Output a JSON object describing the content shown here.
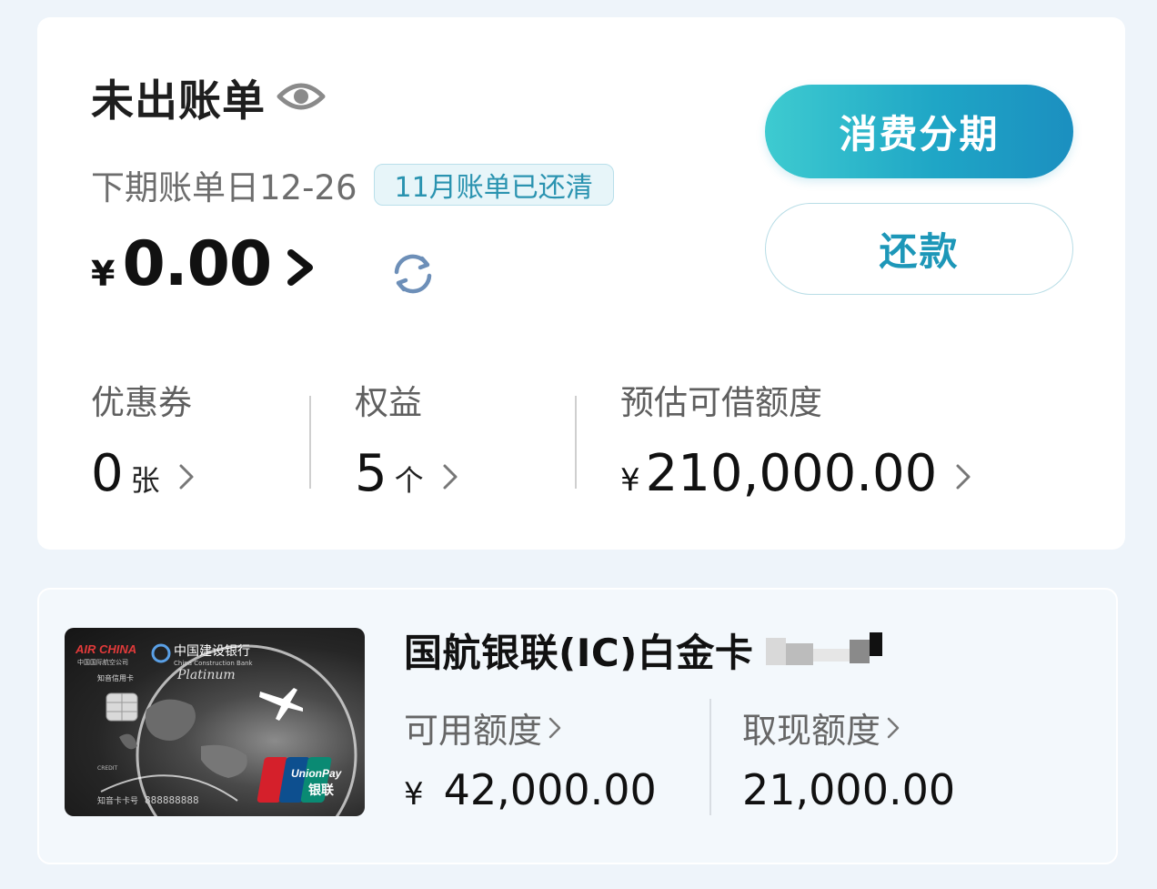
{
  "bill": {
    "title": "未出账单",
    "next_bill_date": "下期账单日12-26",
    "paid_badge": "11月账单已还清",
    "currency": "¥",
    "amount": "0.00",
    "actions": {
      "installment": "消费分期",
      "repay": "还款"
    }
  },
  "stats": [
    {
      "label": "优惠券",
      "value": "0",
      "unit": "张"
    },
    {
      "label": "权益",
      "value": "5",
      "unit": "个"
    },
    {
      "label": "预估可借额度",
      "currency": "¥",
      "value": "210,000.00"
    }
  ],
  "card": {
    "name": "国航银联(IC)白金卡",
    "image_text": {
      "airline": "AIR CHINA",
      "airline_cn": "中国国际航空公司",
      "bank": "中国建设银行",
      "bank_en": "China Construction Bank",
      "card_type": "知音信用卡",
      "tier": "Platinum",
      "network": "UnionPay",
      "network_cn": "银联",
      "card_no_label": "知音卡卡号",
      "card_no": "888888888",
      "credit": "CREDIT"
    },
    "available_limit": {
      "label": "可用额度",
      "currency": "¥",
      "value": "42,000.00"
    },
    "cash_limit": {
      "label": "取现额度",
      "value": "21,000.00"
    }
  },
  "colors": {
    "accent": "#1d97b8",
    "button_gradient_start": "#3ecbd0",
    "button_gradient_end": "#1b8fc0",
    "badge_bg": "#e7f5f9",
    "page_bg": "#eef4fa"
  },
  "icons": [
    "eye-icon",
    "chevron-right-icon",
    "refresh-icon"
  ]
}
